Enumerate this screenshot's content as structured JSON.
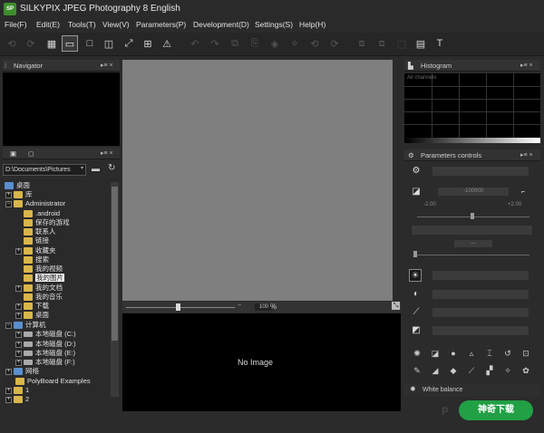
{
  "window": {
    "title": "SILKYPIX JPEG Photography 8 English",
    "logo": "SP"
  },
  "menus": [
    "File(F)",
    "Edit(E)",
    "Tools(T)",
    "View(V)",
    "Parameters(P)",
    "Development(D)",
    "Settings(S)",
    "Help(H)"
  ],
  "navigator": {
    "title": "Navigator",
    "ctrl": "▸≡ ×"
  },
  "folder": {
    "path": "D:\\Documents\\Pictures",
    "ctrl": "▸≡ ×"
  },
  "tree": [
    "桌面",
    "库",
    "Administrator",
    ".android",
    "保存的游戏",
    "联系人",
    "链接",
    "收藏夹",
    "搜索",
    "我的视频",
    "我的图片",
    "我的文档",
    "我的音乐",
    "下载",
    "桌面",
    "计算机",
    "本地磁盘 (C:)",
    "本地磁盘 (D:)",
    "本地磁盘 (E:)",
    "本地磁盘 (F:)",
    "网络",
    "PolyBoard Examples",
    "1",
    "2"
  ],
  "preview": {
    "no_image": "No Image",
    "zoom_value": "100",
    "zoom_unit": "%",
    "zoom_minus": "−"
  },
  "histogram": {
    "title": "Histogram",
    "channel": "All channels",
    "ctrl": "▸≡ ×"
  },
  "params": {
    "title": "Parameters controls",
    "ctrl": "▸≡ ×",
    "exposure_value": "-100000",
    "exposure_min": "-2.00",
    "exposure_max": "+2.00",
    "dash": "---",
    "white_balance": "White balance"
  },
  "watermark": {
    "letter": "P",
    "site": "神奇下载"
  }
}
